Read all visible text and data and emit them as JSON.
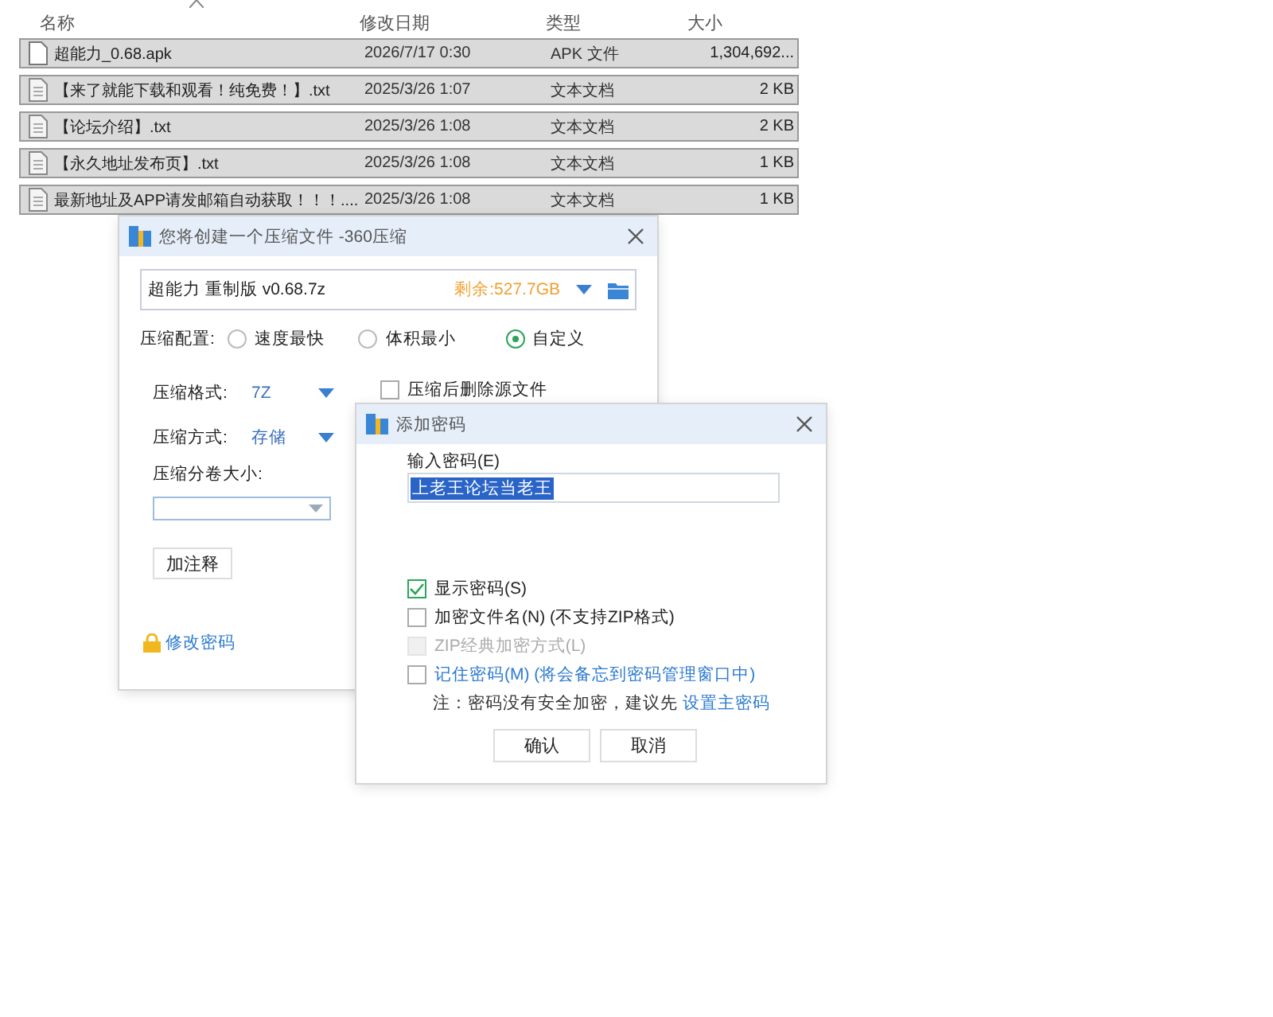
{
  "file_list": {
    "columns": [
      {
        "label": "名称",
        "sorted": true
      },
      {
        "label": "修改日期",
        "sorted": false
      },
      {
        "label": "类型",
        "sorted": false
      },
      {
        "label": "大小",
        "sorted": false
      }
    ],
    "rows": [
      {
        "kind": "apk",
        "name": "超能力_0.68.apk",
        "date": "2026/7/17 0:30",
        "type": "APK 文件",
        "size": "1,304,692...",
        "selected": true
      },
      {
        "kind": "text",
        "name": "【来了就能下载和观看！纯免费！】.txt",
        "date": "2025/3/26 1:07",
        "type": "文本文档",
        "size": "2 KB",
        "selected": true
      },
      {
        "kind": "text",
        "name": "【论坛介绍】.txt",
        "date": "2025/3/26 1:08",
        "type": "文本文档",
        "size": "2 KB",
        "selected": true
      },
      {
        "kind": "text",
        "name": "【永久地址发布页】.txt",
        "date": "2025/3/26 1:08",
        "type": "文本文档",
        "size": "1 KB",
        "selected": true
      },
      {
        "kind": "text",
        "name": "最新地址及APP请发邮箱自动获取！！！....",
        "date": "2025/3/26 1:08",
        "type": "文本文档",
        "size": "1 KB",
        "selected": true
      }
    ]
  },
  "compress_dialog": {
    "title": "您将创建一个压缩文件 -360压缩",
    "archive_name": "超能力 重制版 v0.68.7z",
    "free_space": "剩余:527.7GB",
    "config_label": "压缩配置:",
    "presets": [
      {
        "label": "速度最快",
        "selected": false
      },
      {
        "label": "体积最小",
        "selected": false
      },
      {
        "label": "自定义",
        "selected": true
      }
    ],
    "format_label": "压缩格式:",
    "format_value": "7Z",
    "method_label": "压缩方式:",
    "method_value": "存储",
    "delete_source": {
      "label": "压缩后删除源文件",
      "checked": false
    },
    "split_label": "压缩分卷大小:",
    "comment_button": "加注释",
    "change_password_link": "修改密码"
  },
  "password_dialog": {
    "title": "添加密码",
    "input_label": "输入密码(E)",
    "password": "上老王论坛当老王",
    "options": [
      {
        "label": "显示密码(S)",
        "checked": true,
        "disabled": false,
        "link": false
      },
      {
        "label": "加密文件名(N) (不支持ZIP格式)",
        "checked": false,
        "disabled": false,
        "link": false
      },
      {
        "label": "ZIP经典加密方式(L)",
        "checked": false,
        "disabled": true,
        "link": false
      },
      {
        "label": "记住密码(M) (将会备忘到密码管理窗口中)",
        "checked": false,
        "disabled": false,
        "link": true
      }
    ],
    "note": "注：密码没有安全加密，建议先",
    "note_link": "设置主密码",
    "buttons": [
      "确认",
      "取消"
    ]
  }
}
